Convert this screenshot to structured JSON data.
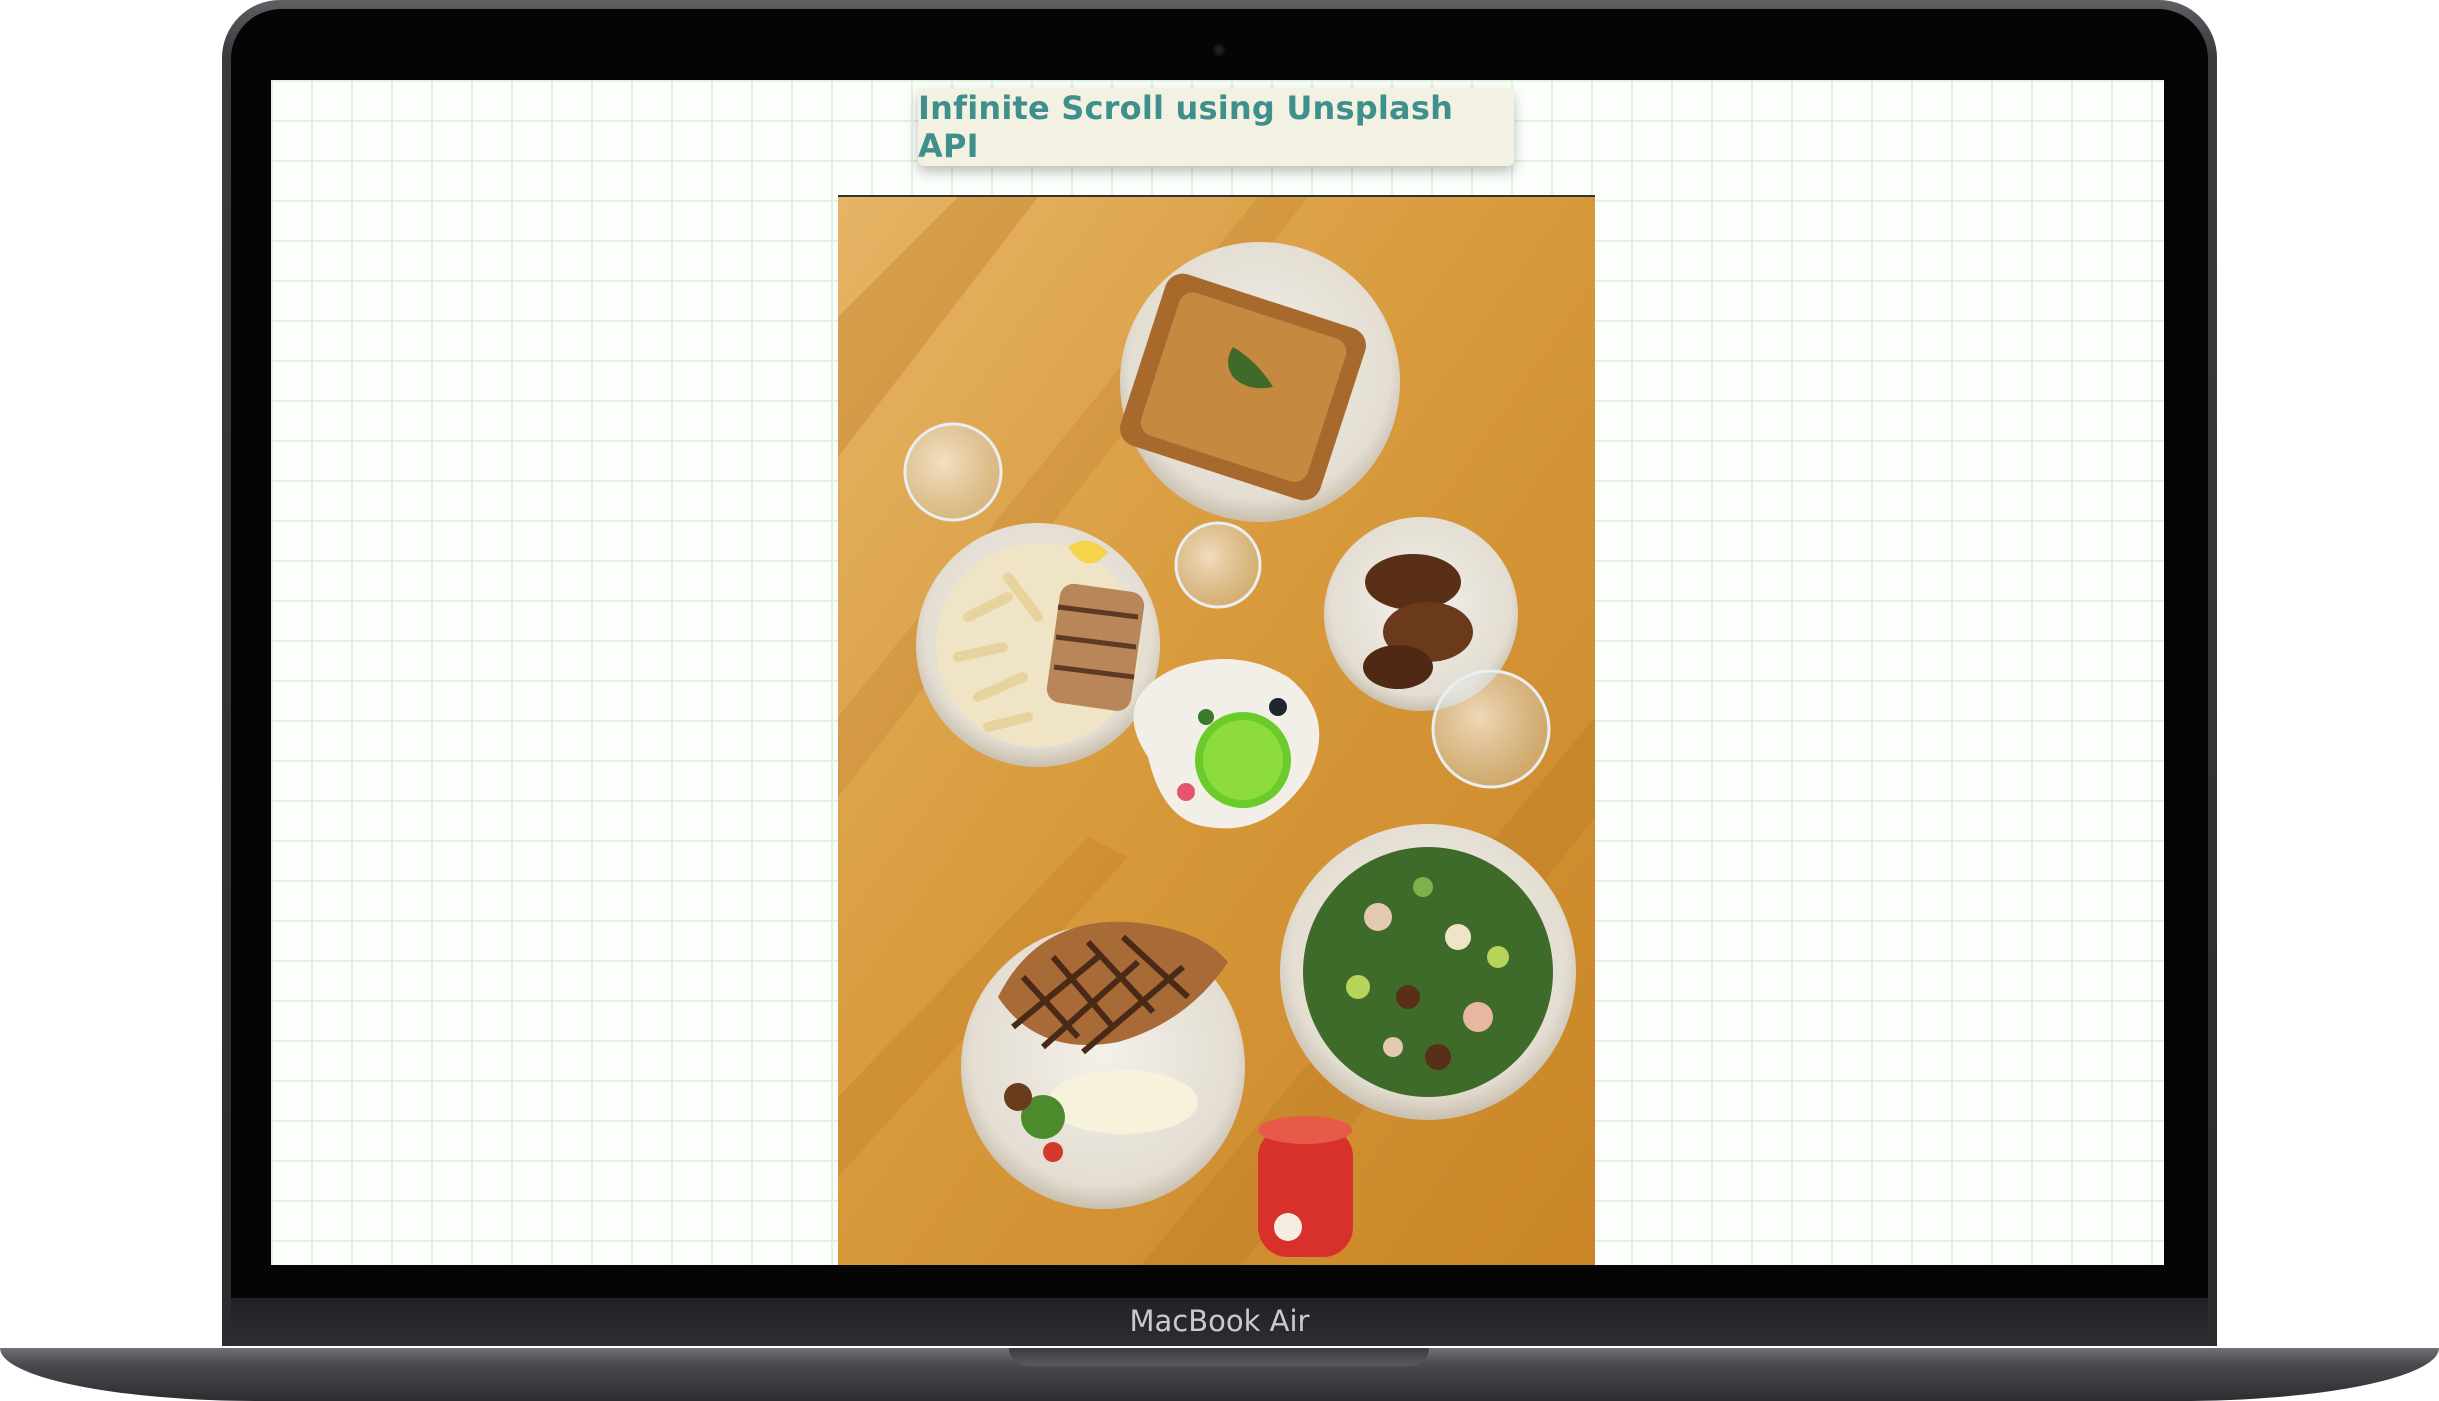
{
  "device": {
    "model_label": "MacBook Air"
  },
  "page": {
    "title": "Infinite Scroll using Unsplash API"
  },
  "feed": {
    "images": [
      {
        "subject": "overhead-food-table",
        "visible": true
      }
    ]
  },
  "colors": {
    "title_text": "#3f8f8c",
    "title_card": "#f3f1e2",
    "brick_background": "#fbfefb",
    "brick_lines": "#e0f3e0",
    "table_wood": "#d89a3c"
  },
  "icons": {
    "camera": "camera-dot-icon"
  }
}
